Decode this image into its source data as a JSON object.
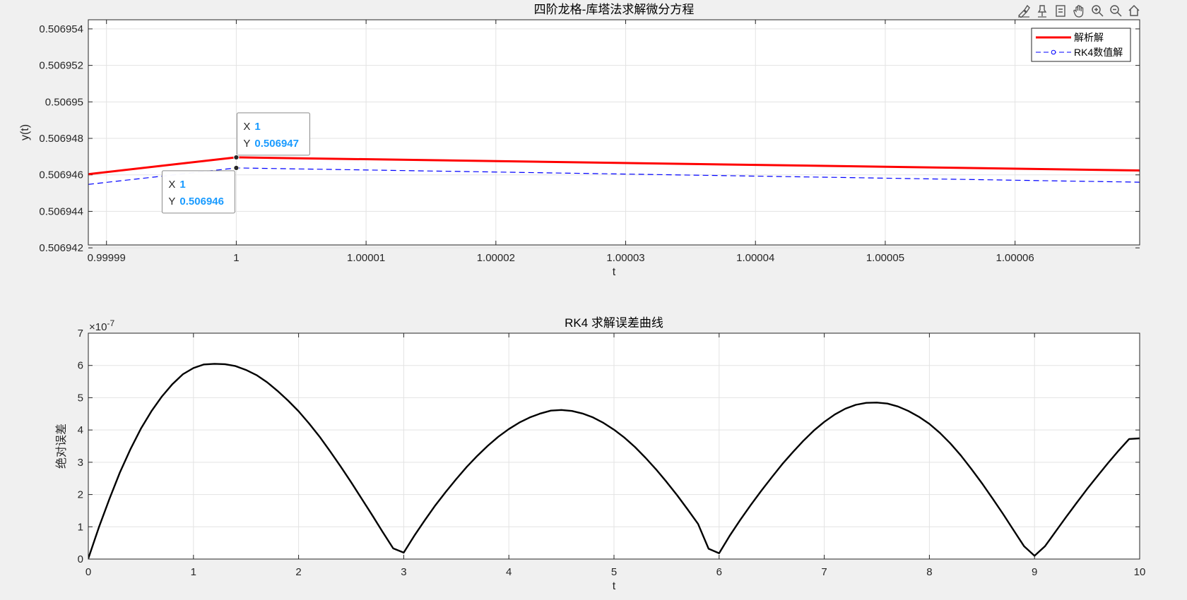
{
  "toolbar": {
    "icons": [
      "brush-icon",
      "pin-icon",
      "legend-icon",
      "pan-icon",
      "zoom-in-icon",
      "zoom-out-icon",
      "home-icon"
    ]
  },
  "chart_data": [
    {
      "type": "line",
      "title": "四阶龙格-库塔法求解微分方程",
      "xlabel": "t",
      "ylabel": "y(t)",
      "xlim": [
        0.9999886,
        1.0000696
      ],
      "ylim": [
        0.50694216,
        0.5069545
      ],
      "xticks": [
        0.99999,
        1,
        1.00001,
        1.00002,
        1.00003,
        1.00004,
        1.00005,
        1.00006
      ],
      "xtick_labels": [
        "0.99999",
        "1",
        "1.00001",
        "1.00002",
        "1.00003",
        "1.00004",
        "1.00005",
        "1.00006"
      ],
      "yticks": [
        0.506942,
        0.506944,
        0.506946,
        0.506948,
        0.50695,
        0.506952,
        0.506954
      ],
      "ytick_labels": [
        "0.506942",
        "0.506944",
        "0.506946",
        "0.506948",
        "0.50695",
        "0.506952",
        "0.506954"
      ],
      "grid": true,
      "legend": "top-right",
      "series": [
        {
          "name": "解析解",
          "color": "#ff0000",
          "style": "solid",
          "x": [
            0.9999886,
            1.0,
            1.0000696
          ],
          "y": [
            0.50694604,
            0.50694696,
            0.50694624
          ]
        },
        {
          "name": "RK4数值解",
          "color": "#0000ff",
          "style": "dashed",
          "marker": "circle",
          "x": [
            0.9999886,
            1.0,
            1.0000696
          ],
          "y": [
            0.50694548,
            0.50694638,
            0.5069456
          ]
        }
      ],
      "datatips": [
        {
          "series": "解析解",
          "x_label": "X",
          "x_value": "1",
          "y_label": "Y",
          "y_value": "0.506947",
          "x": 1.0,
          "y": 0.50694696,
          "side": "above"
        },
        {
          "series": "RK4数值解",
          "x_label": "X",
          "x_value": "1",
          "y_label": "Y",
          "y_value": "0.506946",
          "x": 1.0,
          "y": 0.50694638,
          "side": "below"
        }
      ]
    },
    {
      "type": "line",
      "title": "RK4 求解误差曲线",
      "xlabel": "t",
      "ylabel": "绝对误差",
      "exponent_label": "×10",
      "exponent_power": "-7",
      "xlim": [
        0,
        10
      ],
      "ylim": [
        0,
        7
      ],
      "xticks": [
        0,
        1,
        2,
        3,
        4,
        5,
        6,
        7,
        8,
        9,
        10
      ],
      "yticks": [
        0,
        1,
        2,
        3,
        4,
        5,
        6,
        7
      ],
      "grid": true,
      "series": [
        {
          "name": "",
          "color": "#000000",
          "style": "solid",
          "x": [
            0,
            0.1,
            0.2,
            0.3,
            0.4,
            0.5,
            0.6,
            0.7,
            0.8,
            0.9,
            1.0,
            1.1,
            1.2,
            1.3,
            1.4,
            1.5,
            1.6,
            1.7,
            1.8,
            1.9,
            2.0,
            2.1,
            2.2,
            2.3,
            2.4,
            2.5,
            2.6,
            2.7,
            2.8,
            2.9,
            3.0,
            3.1,
            3.2,
            3.3,
            3.4,
            3.5,
            3.6,
            3.7,
            3.8,
            3.9,
            4.0,
            4.1,
            4.2,
            4.3,
            4.4,
            4.5,
            4.6,
            4.7,
            4.8,
            4.9,
            5.0,
            5.1,
            5.2,
            5.3,
            5.4,
            5.5,
            5.6,
            5.7,
            5.8,
            5.9,
            6.0,
            6.1,
            6.2,
            6.3,
            6.4,
            6.5,
            6.6,
            6.7,
            6.8,
            6.9,
            7.0,
            7.1,
            7.2,
            7.3,
            7.4,
            7.5,
            7.6,
            7.7,
            7.8,
            7.9,
            8.0,
            8.1,
            8.2,
            8.3,
            8.4,
            8.5,
            8.6,
            8.7,
            8.8,
            8.9,
            9.0,
            9.1,
            9.2,
            9.3,
            9.4,
            9.5,
            9.6,
            9.7,
            9.8,
            9.9,
            10.0
          ],
          "y": [
            0.02,
            0.98,
            1.86,
            2.68,
            3.4,
            4.04,
            4.58,
            5.04,
            5.42,
            5.73,
            5.92,
            6.03,
            6.05,
            6.04,
            5.98,
            5.86,
            5.7,
            5.48,
            5.21,
            4.91,
            4.58,
            4.2,
            3.79,
            3.34,
            2.87,
            2.38,
            1.87,
            1.36,
            0.84,
            0.33,
            0.2,
            0.72,
            1.2,
            1.66,
            2.08,
            2.48,
            2.86,
            3.2,
            3.51,
            3.79,
            4.03,
            4.23,
            4.39,
            4.51,
            4.6,
            4.62,
            4.59,
            4.51,
            4.39,
            4.22,
            4.01,
            3.76,
            3.47,
            3.14,
            2.78,
            2.39,
            1.98,
            1.54,
            1.09,
            0.32,
            0.18,
            0.72,
            1.21,
            1.67,
            2.11,
            2.53,
            2.94,
            3.31,
            3.66,
            3.98,
            4.25,
            4.48,
            4.66,
            4.78,
            4.84,
            4.85,
            4.82,
            4.73,
            4.59,
            4.41,
            4.19,
            3.91,
            3.58,
            3.21,
            2.79,
            2.35,
            1.88,
            1.4,
            0.9,
            0.4,
            0.1,
            0.4,
            0.85,
            1.3,
            1.74,
            2.17,
            2.58,
            2.98,
            3.36,
            3.72,
            3.74
          ]
        }
      ]
    }
  ]
}
